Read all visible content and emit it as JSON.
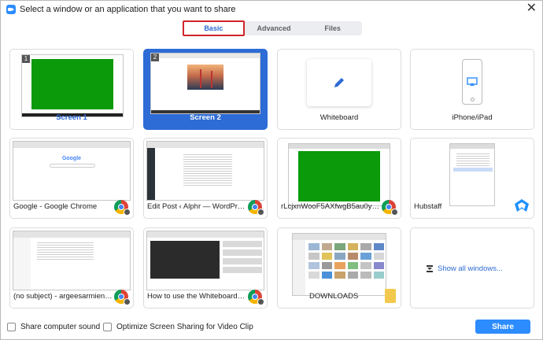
{
  "window": {
    "title": "Select a window or an application that you want to share",
    "close_glyph": "✕"
  },
  "tabs": [
    {
      "label": "Basic",
      "active": true
    },
    {
      "label": "Advanced",
      "active": false
    },
    {
      "label": "Files",
      "active": false
    }
  ],
  "cards": [
    {
      "label": "Screen 1",
      "badge": "1",
      "kind": "screen"
    },
    {
      "label": "Screen 2",
      "badge": "2",
      "kind": "screen",
      "selected": true
    },
    {
      "label": "Whiteboard",
      "kind": "whiteboard",
      "icon": "pen-icon"
    },
    {
      "label": "iPhone/iPad",
      "kind": "device",
      "icon": "airplay-icon"
    },
    {
      "label": "Google - Google Chrome",
      "kind": "window",
      "icon": "chrome-icon"
    },
    {
      "label": "Edit Post ‹ Alphr — WordPress - ...",
      "kind": "window",
      "icon": "chrome-icon"
    },
    {
      "label": "rLcjxnWooF5AXfwgB5au0yWEu8...",
      "kind": "window",
      "icon": "chrome-icon"
    },
    {
      "label": "Hubstaff",
      "kind": "window",
      "icon": "hubstaff-icon"
    },
    {
      "label": "(no subject) - argeesarmiento@g...",
      "kind": "window",
      "icon": "chrome-icon"
    },
    {
      "label": "How to use the Whiteboard in Zo...",
      "kind": "window",
      "icon": "chrome-icon"
    },
    {
      "label": "DOWNLOADS",
      "kind": "window",
      "icon": "folder-icon"
    },
    {
      "label": "Show all windows...",
      "kind": "link",
      "icon": "expand-icon"
    }
  ],
  "thumb_text": {
    "google_logo": "Google"
  },
  "footer": {
    "share_sound_label": "Share computer sound",
    "optimize_label": "Optimize Screen Sharing for Video Clip",
    "share_button": "Share"
  },
  "colors": {
    "accent": "#2d6bd6",
    "share_button": "#2d8cff",
    "tab_highlight_border": "#d0242b",
    "screen_green": "#0a9a0a"
  }
}
